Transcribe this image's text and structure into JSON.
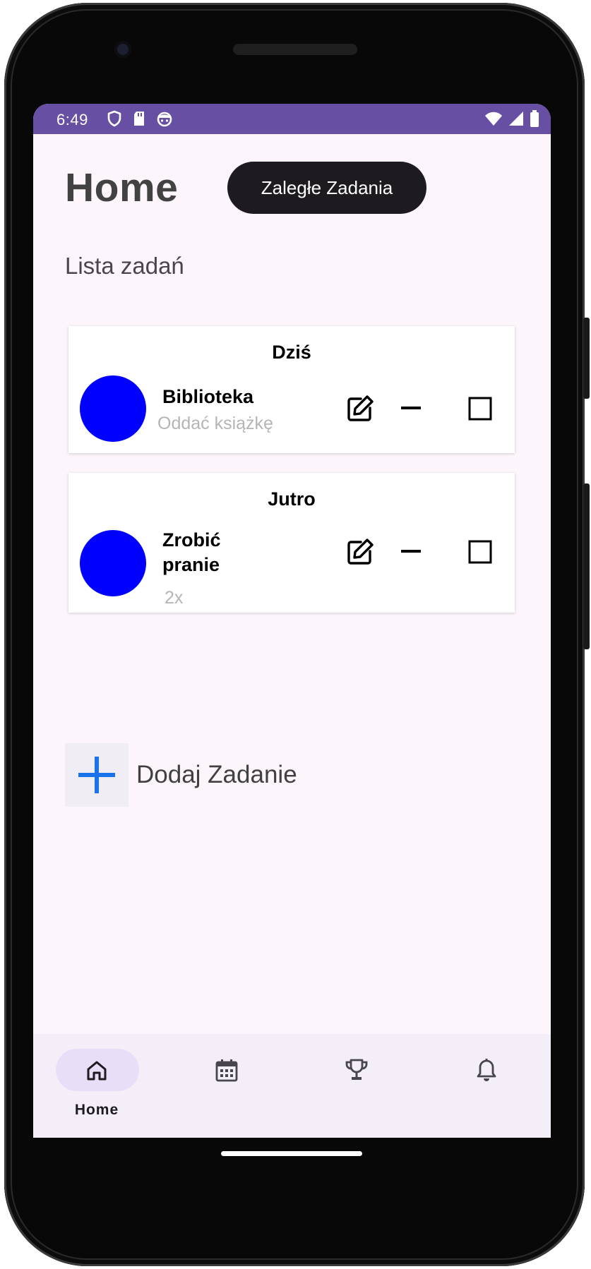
{
  "status_bar": {
    "time": "6:49",
    "icons_left": [
      "shield-icon",
      "sd-card-icon",
      "android-face-icon"
    ],
    "icons_right": [
      "wifi-icon",
      "signal-icon",
      "battery-icon"
    ]
  },
  "header": {
    "title": "Home",
    "overdue_button_label": "Zaległe Zadania"
  },
  "section_label": "Lista zadań",
  "task_groups": [
    {
      "heading": "Dziś",
      "tasks": [
        {
          "title": "Biblioteka",
          "subtitle": "Oddać książkę",
          "avatar_color": "#0000ff"
        }
      ]
    },
    {
      "heading": "Jutro",
      "tasks": [
        {
          "title": "Zrobić pranie",
          "subtitle": "2x",
          "avatar_color": "#0000ff"
        }
      ]
    }
  ],
  "task_actions": [
    "edit-icon",
    "minus-icon",
    "checkbox-icon"
  ],
  "add_task": {
    "label": "Dodaj Zadanie",
    "icon": "plus-icon",
    "icon_color": "#1a73e8"
  },
  "bottom_nav": {
    "items": [
      {
        "label": "Home",
        "icon": "home-icon",
        "selected": true
      },
      {
        "label": "",
        "icon": "calendar-icon",
        "selected": false
      },
      {
        "label": "",
        "icon": "trophy-icon",
        "selected": false
      },
      {
        "label": "",
        "icon": "bell-icon",
        "selected": false
      }
    ]
  },
  "colors": {
    "status_bar": "#6750a4",
    "screen_background": "#fcf6fc",
    "overdue_button": "#1d1b20",
    "nav_background": "#f3eef7",
    "nav_selected_pill": "#e8def8"
  }
}
